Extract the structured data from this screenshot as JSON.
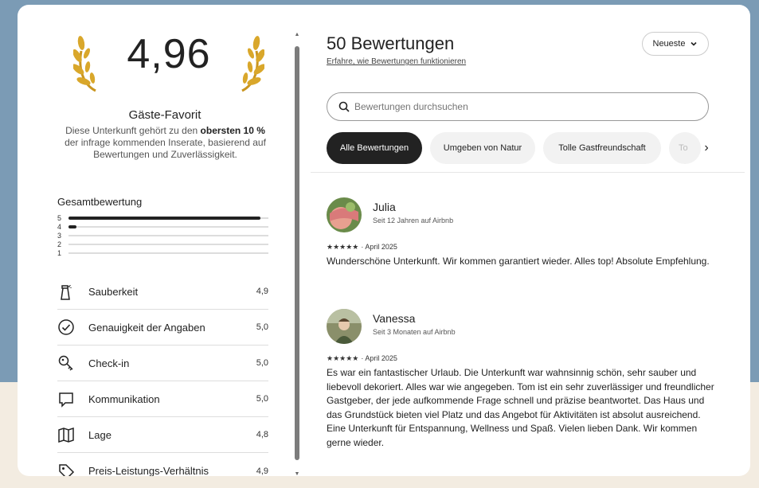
{
  "summary": {
    "rating": "4,96",
    "favorite_title": "Gäste-Favorit",
    "favorite_desc_1": "Diese Unterkunft gehört zu den ",
    "favorite_desc_bold": "obersten 10 %",
    "favorite_desc_2": " der infrage kommenden Inserate, basierend auf Bewertungen und Zuverlässigkeit.",
    "overall_label": "Gesamtbewertung",
    "distribution": [
      {
        "stars": "5",
        "share": 0.96
      },
      {
        "stars": "4",
        "share": 0.04
      },
      {
        "stars": "3",
        "share": 0
      },
      {
        "stars": "2",
        "share": 0
      },
      {
        "stars": "1",
        "share": 0
      }
    ],
    "categories": [
      {
        "icon": "spray-bottle-icon",
        "label": "Sauberkeit",
        "value": "4,9"
      },
      {
        "icon": "check-circle-icon",
        "label": "Genauigkeit der Angaben",
        "value": "5,0"
      },
      {
        "icon": "key-icon",
        "label": "Check-in",
        "value": "5,0"
      },
      {
        "icon": "message-bubble-icon",
        "label": "Kommunikation",
        "value": "5,0"
      },
      {
        "icon": "map-icon",
        "label": "Lage",
        "value": "4,8"
      },
      {
        "icon": "price-tag-icon",
        "label": "Preis-Leistungs-Verhältnis",
        "value": "4,9"
      }
    ]
  },
  "reviews_header": {
    "title": "50 Bewertungen",
    "link": "Erfahre, wie Bewertungen funktionieren",
    "sort_label": "Neueste"
  },
  "search": {
    "placeholder": "Bewertungen durchsuchen"
  },
  "filters": [
    {
      "label": "Alle Bewertungen",
      "active": true
    },
    {
      "label": "Umgeben von Natur",
      "active": false
    },
    {
      "label": "Tolle Gastfreundschaft",
      "active": false
    },
    {
      "label": "To",
      "active": false
    }
  ],
  "reviews": [
    {
      "name": "Julia",
      "since": "Seit 12 Jahren auf Airbnb",
      "stars": "★★★★★",
      "date": "· April 2025",
      "text": "Wunderschöne Unterkunft. Wir kommen garantiert wieder. Alles top! Absolute Empfehlung."
    },
    {
      "name": "Vanessa",
      "since": "Seit 3 Monaten auf Airbnb",
      "stars": "★★★★★",
      "date": "· April 2025",
      "text": "Es war ein fantastischer Urlaub. Die Unterkunft war wahnsinnig schön, sehr sauber und liebevoll dekoriert. Alles war wie angegeben. Tom ist ein sehr zuverlässiger und freundlicher Gastgeber, der jede aufkommende Frage schnell und präzise beantwortet.  Das Haus und das Grundstück bieten viel Platz und das Angebot für Aktivitäten ist absolut ausreichend. Eine Unterkunft für Entspannung, Wellness und Spaß.  Vielen lieben Dank. Wir kommen gerne wieder."
    }
  ],
  "colors": {
    "background_blue": "#7b9bb5",
    "background_cream": "#f3ece1",
    "laurel_gold": "#d9a72b",
    "active_chip": "#222222"
  }
}
